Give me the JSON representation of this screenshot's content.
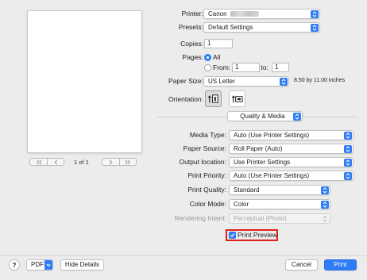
{
  "printer": {
    "label": "Printer:",
    "value": "Canon"
  },
  "presets": {
    "label": "Presets:",
    "value": "Default Settings"
  },
  "copies": {
    "label": "Copies:",
    "value": "1"
  },
  "pages": {
    "label": "Pages:",
    "all_label": "All",
    "from_label": "From:",
    "from_value": "1",
    "to_label": "to:",
    "to_value": "1",
    "selected": "All"
  },
  "paper_size": {
    "label": "Paper Size:",
    "value": "US Letter",
    "dimensions": "8.50 by 11.00 inches"
  },
  "orientation": {
    "label": "Orientation:",
    "selected": "portrait"
  },
  "section": {
    "value": "Quality & Media"
  },
  "settings": [
    {
      "key": "media_type",
      "label": "Media Type:",
      "value": "Auto (Use Printer Settings)",
      "enabled": true
    },
    {
      "key": "paper_source",
      "label": "Paper Source:",
      "value": "Roll Paper (Auto)",
      "enabled": true
    },
    {
      "key": "output_location",
      "label": "Output location:",
      "value": "Use Printer Settings",
      "enabled": true
    },
    {
      "key": "print_priority",
      "label": "Print Priority:",
      "value": "Auto (Use Printer Settings)",
      "enabled": true
    },
    {
      "key": "print_quality",
      "label": "Print Quality:",
      "value": "Standard",
      "enabled": true
    },
    {
      "key": "color_mode",
      "label": "Color Mode:",
      "value": "Color",
      "enabled": true
    },
    {
      "key": "rendering_intent",
      "label": "Rendering Intent:",
      "value": "Perceptual (Photo)",
      "enabled": false
    }
  ],
  "print_preview": {
    "label": "Print Preview",
    "checked": true
  },
  "preview": {
    "page_indicator": "1 of 1"
  },
  "footer": {
    "help_label": "?",
    "pdf_label": "PDF",
    "hide_details_label": "Hide Details",
    "cancel_label": "Cancel",
    "print_label": "Print"
  },
  "colors": {
    "accent": "#2f7cf6",
    "highlight": "#e2201a",
    "background": "#ececec"
  }
}
